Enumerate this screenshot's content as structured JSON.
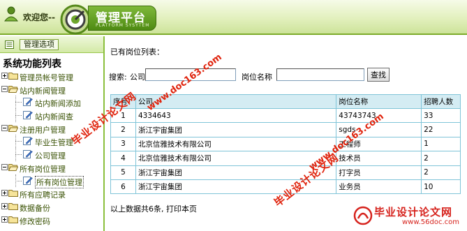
{
  "header": {
    "welcome": "欢迎您--",
    "logo_title": "管理平台",
    "logo_subtitle": "PLATFORM SYSYTEM"
  },
  "sidebar": {
    "options_button": "管理选项",
    "title": "系统功能列表",
    "tree": [
      {
        "label": "管理员帐号管理",
        "level": 0,
        "expanded": false
      },
      {
        "label": "站内新闻管理",
        "level": 0,
        "expanded": true
      },
      {
        "label": "站内新闻添加",
        "level": 1
      },
      {
        "label": "站内新闻查",
        "level": 1
      },
      {
        "label": "注册用户管理",
        "level": 0,
        "expanded": true
      },
      {
        "label": "毕业生管理",
        "level": 1
      },
      {
        "label": "公司管理",
        "level": 1
      },
      {
        "label": "所有岗位管理",
        "level": 0,
        "expanded": true
      },
      {
        "label": "所有岗位管理",
        "level": 1,
        "selected": true
      },
      {
        "label": "所有应聘记录",
        "level": 0,
        "expanded": false
      },
      {
        "label": "数据备份",
        "level": 0,
        "expanded": false
      },
      {
        "label": "修改密码",
        "level": 0,
        "expanded": false
      }
    ]
  },
  "main": {
    "heading": "已有岗位列表：",
    "search": {
      "label": "搜索:",
      "company_label": "公司",
      "company_value": "",
      "position_label": "岗位名称",
      "position_value": "",
      "button": "查找"
    },
    "table": {
      "columns": [
        "序号",
        "公司",
        "岗位名称",
        "招聘人数"
      ],
      "rows": [
        [
          "1",
          "4334643",
          "43743743",
          "33"
        ],
        [
          "2",
          "浙江宇宙集团",
          "sgds",
          "22"
        ],
        [
          "3",
          "北京信雅技术有限公司",
          "工程师",
          "1"
        ],
        [
          "4",
          "北京信雅技术有限公司",
          "技术员",
          "2"
        ],
        [
          "5",
          "浙江宇宙集团",
          "打字员",
          "2"
        ],
        [
          "6",
          "浙江宇宙集团",
          "业务员",
          "10"
        ]
      ]
    },
    "footer": "以上数据共6条, 打印本页"
  },
  "watermarks": {
    "cn_text": "毕业设计论文网",
    "url_text": "www.doc163.com",
    "brand_title": "毕业设计论文网",
    "brand_url": "www.56doc.com"
  },
  "colors": {
    "header_green": "#7cab2a",
    "tree_text": "#3a5204",
    "table_header_bg": "#d4ecf3",
    "table_border": "#7fc4d8",
    "watermark_red": "#e0240e"
  }
}
